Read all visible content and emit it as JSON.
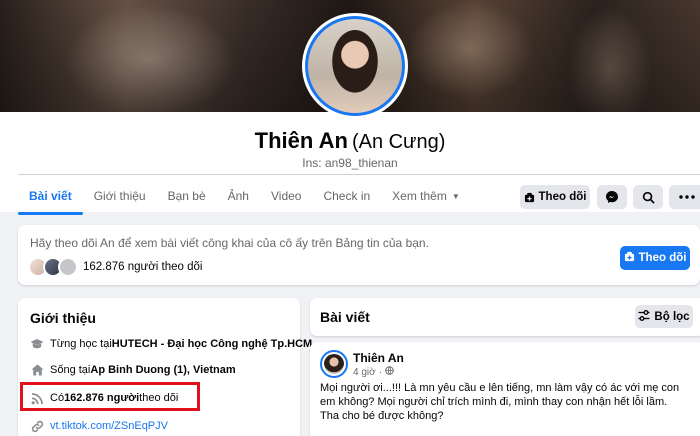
{
  "profile": {
    "name": "Thiên An",
    "alt_name": "(An Cưng)",
    "instagram": "Ins: an98_thienan"
  },
  "nav": {
    "tabs": [
      "Bài viết",
      "Giới thiệu",
      "Bạn bè",
      "Ảnh",
      "Video",
      "Check in",
      "Xem thêm"
    ],
    "active_tab": "Bài viết"
  },
  "actions": {
    "follow_label": "Theo dõi"
  },
  "banner": {
    "text": "Hãy theo dõi An để xem bài viết công khai của cô ấy trên Bảng tin của bạn.",
    "followers_text": "162.876 người theo dõi",
    "follow_button": "Theo dõi"
  },
  "intro": {
    "title": "Giới thiệu",
    "education_prefix": "Từng học tại ",
    "education_school": "HUTECH - Đại học Công nghệ Tp.HCM",
    "lives_prefix": "Sống tại ",
    "lives_place": "Ap Binh Duong (1), Vietnam",
    "followers_prefix": "Có ",
    "followers_count": "162.876 người",
    "followers_suffix": " theo dõi",
    "link": "vt.tiktok.com/ZSnEqPJV"
  },
  "posts": {
    "title": "Bài viết",
    "filter_label": "Bộ lọc",
    "post": {
      "author": "Thiên An",
      "time": "4 giờ",
      "body": "Mọi người ơi...!!! Là mn yêu cầu e lên tiếng, mn làm vậy có ác với mẹ con em không? Mọi người chỉ trích mình đi, mình thay con nhận hết lỗi lầm. Tha cho bé được không?"
    }
  },
  "colors": {
    "accent": "#1877f2",
    "highlight": "#e0111b",
    "page_bg": "#f0f2f5"
  }
}
